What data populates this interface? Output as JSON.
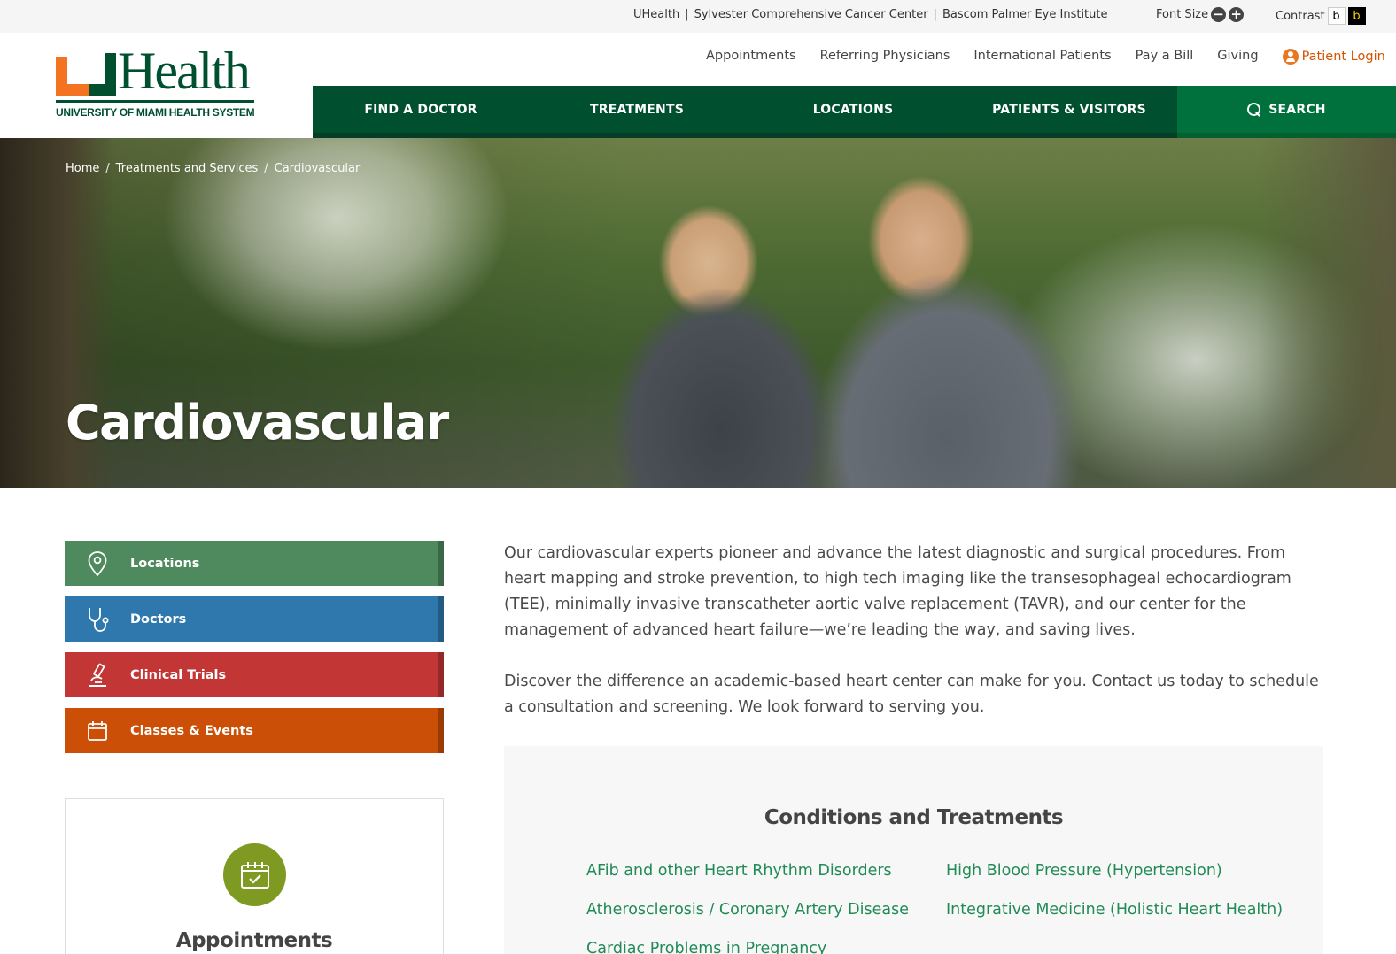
{
  "utility": {
    "links": [
      "UHealth",
      "Sylvester Comprehensive Cancer Center",
      "Bascom Palmer Eye Institute"
    ],
    "separator": "|",
    "font_size_label": "Font Size",
    "font_decrease": "−",
    "font_increase": "+",
    "contrast_label": "Contrast",
    "contrast_light": "b",
    "contrast_dark": "b"
  },
  "logo": {
    "wordmark": "Health",
    "subtitle": "UNIVERSITY OF MIAMI HEALTH SYSTEM"
  },
  "topnav": {
    "items": [
      "Appointments",
      "Referring Physicians",
      "International Patients",
      "Pay a Bill",
      "Giving"
    ],
    "login": "Patient Login"
  },
  "mainnav": {
    "items": [
      "FIND A DOCTOR",
      "TREATMENTS",
      "LOCATIONS",
      "PATIENTS & VISITORS"
    ],
    "search": "SEARCH"
  },
  "hero": {
    "breadcrumb": [
      "Home",
      "Treatments and Services",
      "Cardiovascular"
    ],
    "breadcrumb_sep": "/",
    "title": "Cardiovascular"
  },
  "sidenav": {
    "items": [
      {
        "label": "Locations",
        "icon": "map-pin-icon",
        "color": "#4e8a5d"
      },
      {
        "label": "Doctors",
        "icon": "stethoscope-icon",
        "color": "#2e78ad"
      },
      {
        "label": "Clinical Trials",
        "icon": "microscope-icon",
        "color": "#c33636"
      },
      {
        "label": "Classes & Events",
        "icon": "calendar-icon",
        "color": "#cb4f06"
      }
    ]
  },
  "appointments_card": {
    "title": "Appointments",
    "icon": "calendar-check-icon"
  },
  "intro": {
    "p1": "Our cardiovascular experts pioneer and advance the latest diagnostic and surgical procedures. From heart mapping and stroke prevention, to high tech imaging like the transesophageal echocardiogram (TEE), minimally invasive transcatheter aortic valve replacement (TAVR), and our center for the management of advanced heart failure—we’re leading the way, and saving lives.",
    "p2": "Discover the difference an academic-based heart center can make for you. Contact us today to schedule a consultation and screening. We look forward to serving you."
  },
  "conditions": {
    "title": "Conditions and Treatments",
    "col1": [
      "AFib and other Heart Rhythm Disorders",
      "Atherosclerosis / Coronary Artery Disease",
      "Cardiac Problems in Pregnancy"
    ],
    "col2": [
      "High Blood Pressure (Hypertension)",
      "Integrative Medicine (Holistic Heart Health)"
    ]
  },
  "colors": {
    "brand_green": "#005030",
    "brand_orange": "#f47321",
    "link_green": "#218b56",
    "login_orange": "#d35400"
  }
}
